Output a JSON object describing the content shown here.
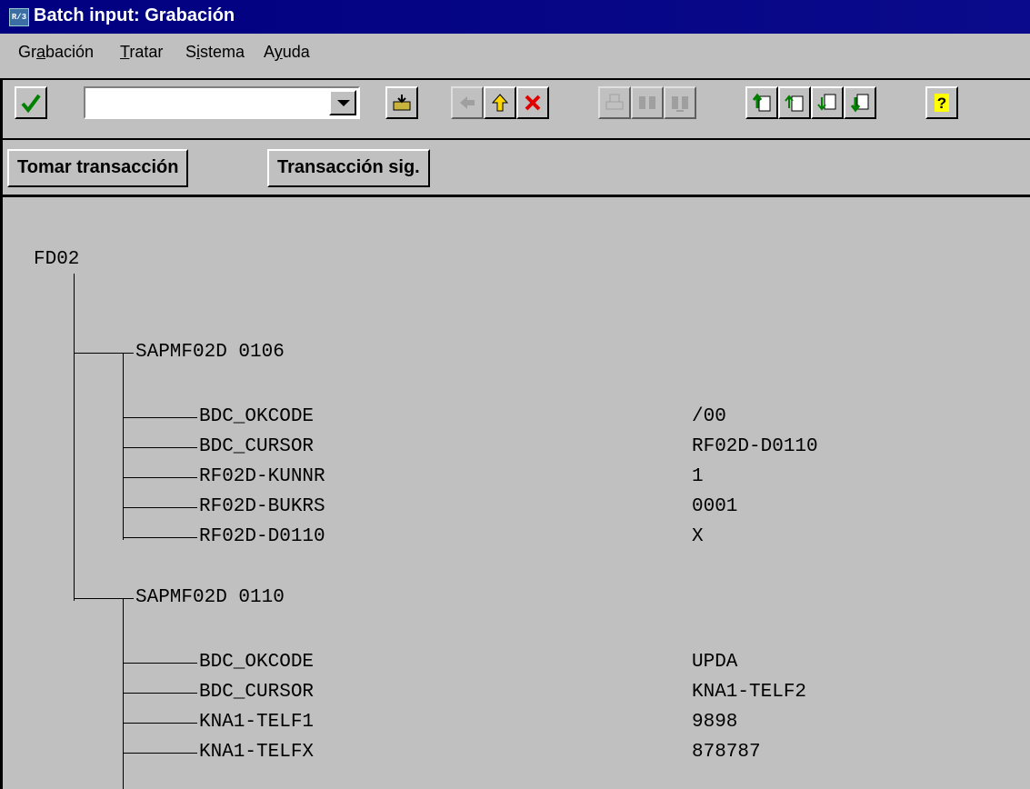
{
  "window": {
    "title": "Batch input: Grabación",
    "icon": "sap-window-icon"
  },
  "menubar": [
    {
      "pre": "Gr",
      "u": "a",
      "post": "bación"
    },
    {
      "pre": "",
      "u": "T",
      "post": "ratar"
    },
    {
      "pre": "S",
      "u": "i",
      "post": "stema"
    },
    {
      "pre": "A",
      "u": "y",
      "post": "uda"
    }
  ],
  "toolbar": {
    "command_value": "",
    "icons": [
      "checkmark-icon",
      "save-icon",
      "back-icon",
      "exit-icon",
      "cancel-icon",
      "print-icon",
      "find-icon",
      "find-next-icon",
      "first-page-icon",
      "previous-page-icon",
      "next-page-icon",
      "last-page-icon",
      "help-icon"
    ]
  },
  "appbar": {
    "take_transaction": "Tomar transacción",
    "next_transaction": "Transacción sig."
  },
  "tree": {
    "root": "FD02",
    "screens": [
      {
        "label": "SAPMF02D 0106",
        "fields": [
          {
            "name": "BDC_OKCODE",
            "value": "/00"
          },
          {
            "name": "BDC_CURSOR",
            "value": "RF02D-D0110"
          },
          {
            "name": "RF02D-KUNNR",
            "value": "1"
          },
          {
            "name": "RF02D-BUKRS",
            "value": "0001"
          },
          {
            "name": "RF02D-D0110",
            "value": "X"
          }
        ]
      },
      {
        "label": "SAPMF02D 0110",
        "fields": [
          {
            "name": "BDC_OKCODE",
            "value": "UPDA"
          },
          {
            "name": "BDC_CURSOR",
            "value": "KNA1-TELF2"
          },
          {
            "name": "KNA1-TELF1",
            "value": "9898"
          },
          {
            "name": "KNA1-TELFX",
            "value": "878787"
          }
        ]
      }
    ]
  }
}
